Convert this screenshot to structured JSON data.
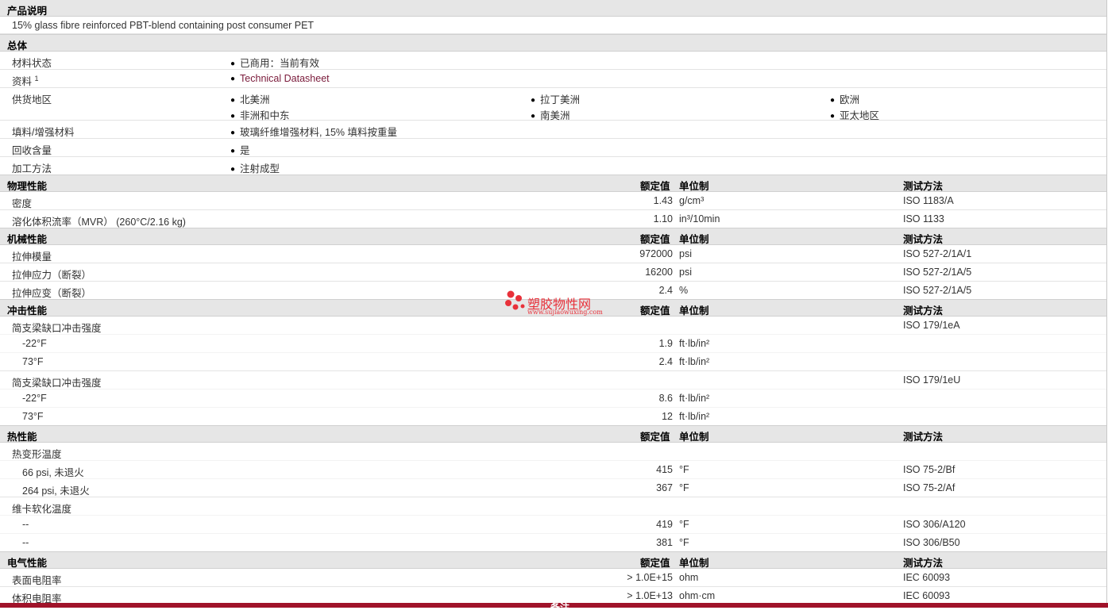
{
  "desc": {
    "header": "产品说明",
    "text": "15% glass fibre reinforced PBT-blend containing post consumer PET"
  },
  "general": {
    "header": "总体",
    "status_label": "材料状态",
    "status_value": "已商用：当前有效",
    "doc_label": "资料",
    "doc_sup": "1",
    "doc_link": "Technical Datasheet",
    "supply_label": "供货地区",
    "regions": [
      "北美洲",
      "拉丁美洲",
      "欧洲",
      "非洲和中东",
      "南美洲",
      "亚太地区"
    ],
    "filler_label": "填料/增强材料",
    "filler_value": "玻璃纤维增强材料, 15% 填料按重量",
    "recycle_label": "回收含量",
    "recycle_value": "是",
    "process_label": "加工方法",
    "process_value": "注射成型"
  },
  "cols": {
    "nominal": "额定值",
    "unit": "单位制",
    "test": "测试方法"
  },
  "physical": {
    "header": "物理性能",
    "rows": [
      {
        "label": "密度",
        "value": "1.43",
        "unit": "g/cm³",
        "test": "ISO 1183/A"
      },
      {
        "label": "溶化体积流率（MVR） (260°C/2.16 kg)",
        "value": "1.10",
        "unit": "in³/10min",
        "test": "ISO 1133"
      }
    ]
  },
  "mechanical": {
    "header": "机械性能",
    "rows": [
      {
        "label": "拉伸模量",
        "value": "972000",
        "unit": "psi",
        "test": "ISO 527-2/1A/1"
      },
      {
        "label": "拉伸应力（断裂）",
        "value": "16200",
        "unit": "psi",
        "test": "ISO 527-2/1A/5"
      },
      {
        "label": "拉伸应变（断裂）",
        "value": "2.4",
        "unit": "%",
        "test": "ISO 527-2/1A/5"
      }
    ]
  },
  "impact": {
    "header": "冲击性能",
    "g1": {
      "label": "简支梁缺口冲击强度",
      "test": "ISO 179/1eA",
      "rows": [
        {
          "label": "-22°F",
          "value": "1.9",
          "unit": "ft·lb/in²"
        },
        {
          "label": "73°F",
          "value": "2.4",
          "unit": "ft·lb/in²"
        }
      ]
    },
    "g2": {
      "label": "简支梁缺口冲击强度",
      "test": "ISO 179/1eU",
      "rows": [
        {
          "label": "-22°F",
          "value": "8.6",
          "unit": "ft·lb/in²"
        },
        {
          "label": "73°F",
          "value": "12",
          "unit": "ft·lb/in²"
        }
      ]
    }
  },
  "thermal": {
    "header": "热性能",
    "g1": {
      "label": "热变形温度",
      "rows": [
        {
          "label": "66 psi, 未退火",
          "value": "415",
          "unit": "°F",
          "test": "ISO 75-2/Bf"
        },
        {
          "label": "264 psi, 未退火",
          "value": "367",
          "unit": "°F",
          "test": "ISO 75-2/Af"
        }
      ]
    },
    "g2": {
      "label": "维卡软化温度",
      "rows": [
        {
          "label": "--",
          "value": "419",
          "unit": "°F",
          "test": "ISO 306/A120"
        },
        {
          "label": "--",
          "value": "381",
          "unit": "°F",
          "test": "ISO 306/B50"
        }
      ]
    }
  },
  "electrical": {
    "header": "电气性能",
    "rows": [
      {
        "label": "表面电阻率",
        "value": "> 1.0E+15",
        "unit": "ohm",
        "test": "IEC 60093"
      },
      {
        "label": "体积电阻率",
        "value": "> 1.0E+13",
        "unit": "ohm·cm",
        "test": "IEC 60093"
      }
    ]
  },
  "footer_label": "备注",
  "watermark": {
    "name": "塑胶物性网",
    "url": "www.sujiaowuxing.com",
    "color": "#e8313a"
  }
}
